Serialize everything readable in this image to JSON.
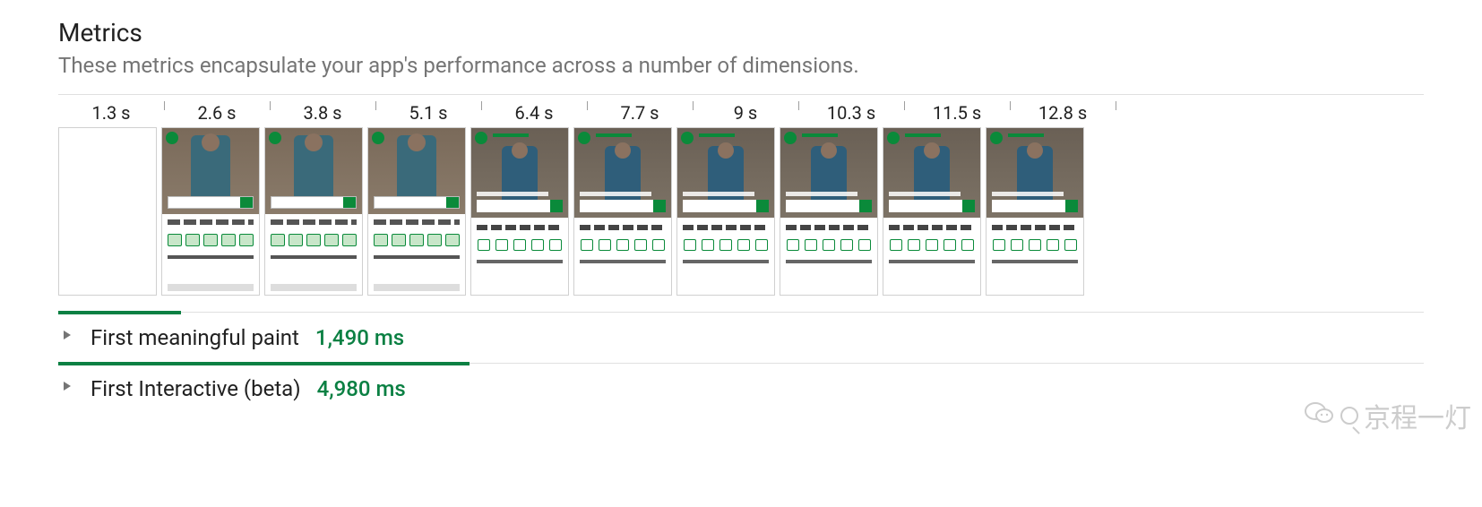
{
  "header": {
    "title": "Metrics",
    "subtitle": "These metrics encapsulate your app's performance across a number of dimensions."
  },
  "filmstrip": {
    "times": [
      "1.3 s",
      "2.6 s",
      "3.8 s",
      "5.1 s",
      "6.4 s",
      "7.7 s",
      "9 s",
      "10.3 s",
      "11.5 s",
      "12.8 s"
    ],
    "frames": [
      {
        "state": "blank"
      },
      {
        "state": "a"
      },
      {
        "state": "a"
      },
      {
        "state": "a"
      },
      {
        "state": "b"
      },
      {
        "state": "b"
      },
      {
        "state": "b"
      },
      {
        "state": "b"
      },
      {
        "state": "b"
      },
      {
        "state": "b"
      }
    ]
  },
  "metrics": [
    {
      "name": "First meaningful paint",
      "value": "1,490 ms",
      "value_ms": 1490,
      "bar_pct": 11.6
    },
    {
      "name": "First Interactive (beta)",
      "value": "4,980 ms",
      "value_ms": 4980,
      "bar_pct": 38.9
    }
  ],
  "watermark": {
    "text": "京程一灯"
  }
}
